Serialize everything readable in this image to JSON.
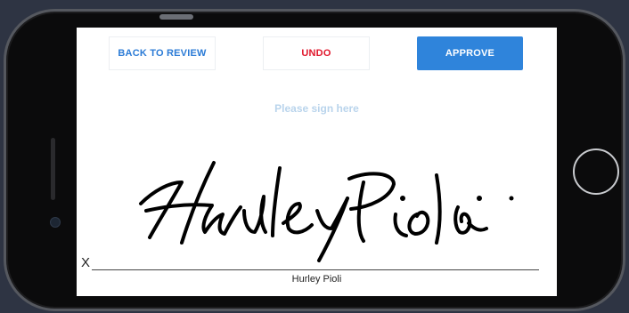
{
  "toolbar": {
    "back_label": "BACK TO REVIEW",
    "undo_label": "UNDO",
    "approve_label": "APPROVE"
  },
  "signature_pad": {
    "placeholder": "Please sign here",
    "x_mark": "X",
    "signer_name": "Hurley Pioli",
    "ink_color": "#000000"
  },
  "colors": {
    "accent": "#2f84db",
    "undo": "#e0162b",
    "hint": "#b9d4ec"
  },
  "icons": [
    "home-button-icon",
    "camera-icon"
  ]
}
